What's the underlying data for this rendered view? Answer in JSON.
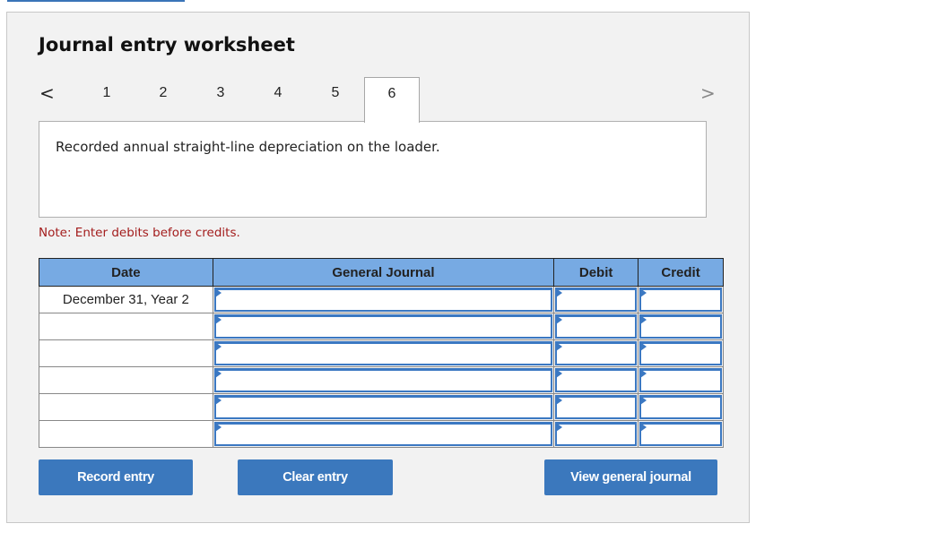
{
  "worksheet": {
    "title": "Journal entry worksheet",
    "nav": {
      "prev_icon": "chevron-left-icon",
      "next_icon": "chevron-right-icon",
      "prev_glyph": "<",
      "next_glyph": ">",
      "tabs": [
        {
          "label": "1",
          "active": false
        },
        {
          "label": "2",
          "active": false
        },
        {
          "label": "3",
          "active": false
        },
        {
          "label": "4",
          "active": false
        },
        {
          "label": "5",
          "active": false
        },
        {
          "label": "6",
          "active": true
        }
      ]
    },
    "description": "Recorded annual straight-line depreciation on the loader.",
    "note": "Note: Enter debits before credits.",
    "table": {
      "headers": [
        "Date",
        "General Journal",
        "Debit",
        "Credit"
      ],
      "header_color": "#77aae3",
      "rows": [
        {
          "date": "December 31, Year 2",
          "account": "",
          "debit": "",
          "credit": ""
        },
        {
          "date": "",
          "account": "",
          "debit": "",
          "credit": ""
        },
        {
          "date": "",
          "account": "",
          "debit": "",
          "credit": ""
        },
        {
          "date": "",
          "account": "",
          "debit": "",
          "credit": ""
        },
        {
          "date": "",
          "account": "",
          "debit": "",
          "credit": ""
        },
        {
          "date": "",
          "account": "",
          "debit": "",
          "credit": ""
        }
      ]
    },
    "buttons": {
      "record": "Record entry",
      "clear": "Clear entry",
      "view": "View general journal"
    },
    "colors": {
      "button": "#3b78bd",
      "note": "#a31c1c",
      "panel_bg": "#f2f2f2"
    }
  }
}
